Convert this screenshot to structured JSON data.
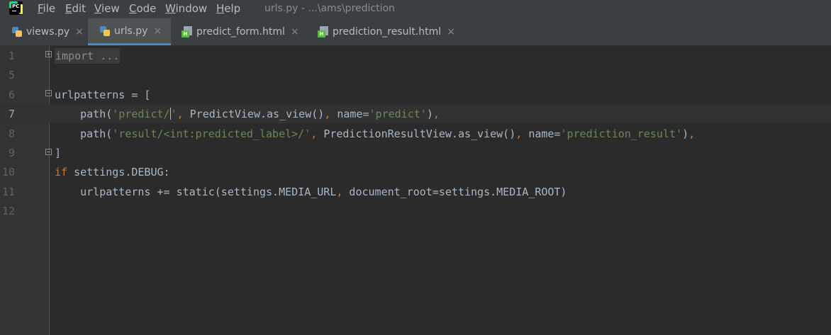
{
  "menu": {
    "items": [
      {
        "underline": "F",
        "rest": "ile"
      },
      {
        "underline": "E",
        "rest": "dit"
      },
      {
        "underline": "V",
        "rest": "iew"
      },
      {
        "underline": "C",
        "rest": "ode"
      },
      {
        "underline": "W",
        "rest": "indow"
      },
      {
        "underline": "H",
        "rest": "elp"
      }
    ],
    "window_title": "urls.py - ...\\ams\\prediction"
  },
  "tabs": [
    {
      "label": "views.py",
      "icon": "python-file-icon",
      "active": false
    },
    {
      "label": "urls.py",
      "icon": "python-file-icon",
      "active": true
    },
    {
      "label": "predict_form.html",
      "icon": "html-file-icon",
      "active": false
    },
    {
      "label": "prediction_result.html",
      "icon": "html-file-icon",
      "active": false
    }
  ],
  "close_glyph": "×",
  "editor": {
    "current_line": "7",
    "lines": [
      {
        "number": "1",
        "tokens": [
          {
            "t": "import ...",
            "c": "fold"
          }
        ]
      },
      {
        "number": "5",
        "tokens": []
      },
      {
        "number": "6",
        "tokens": [
          {
            "t": "urlpatterns = [",
            "c": ""
          }
        ]
      },
      {
        "number": "7",
        "tokens": [
          {
            "t": "    path(",
            "c": ""
          },
          {
            "t": "'predict/",
            "c": "str"
          },
          {
            "t": "",
            "c": "caret"
          },
          {
            "t": "'",
            "c": "str"
          },
          {
            "t": ", ",
            "c": "kw"
          },
          {
            "t": "PredictView.as_view()",
            "c": ""
          },
          {
            "t": ", ",
            "c": "kw"
          },
          {
            "t": "name=",
            "c": ""
          },
          {
            "t": "'predict'",
            "c": "str"
          },
          {
            "t": ")",
            "c": ""
          },
          {
            "t": ",",
            "c": "kw"
          }
        ]
      },
      {
        "number": "8",
        "tokens": [
          {
            "t": "    path(",
            "c": ""
          },
          {
            "t": "'result/<int:predicted_label>/'",
            "c": "str"
          },
          {
            "t": ", ",
            "c": "kw"
          },
          {
            "t": "PredictionResultView.as_view()",
            "c": ""
          },
          {
            "t": ", ",
            "c": "kw"
          },
          {
            "t": "name=",
            "c": ""
          },
          {
            "t": "'prediction_result'",
            "c": "str"
          },
          {
            "t": ")",
            "c": ""
          },
          {
            "t": ",",
            "c": "kw"
          }
        ]
      },
      {
        "number": "9",
        "tokens": [
          {
            "t": "]",
            "c": ""
          }
        ]
      },
      {
        "number": "10",
        "tokens": [
          {
            "t": "if",
            "c": "kw"
          },
          {
            "t": " settings.DEBUG:",
            "c": ""
          }
        ]
      },
      {
        "number": "11",
        "tokens": [
          {
            "t": "    urlpatterns += static(settings.MEDIA_URL",
            "c": ""
          },
          {
            "t": ", ",
            "c": "kw"
          },
          {
            "t": "document_root=settings.MEDIA_ROOT)",
            "c": ""
          }
        ]
      },
      {
        "number": "12",
        "tokens": []
      }
    ]
  }
}
